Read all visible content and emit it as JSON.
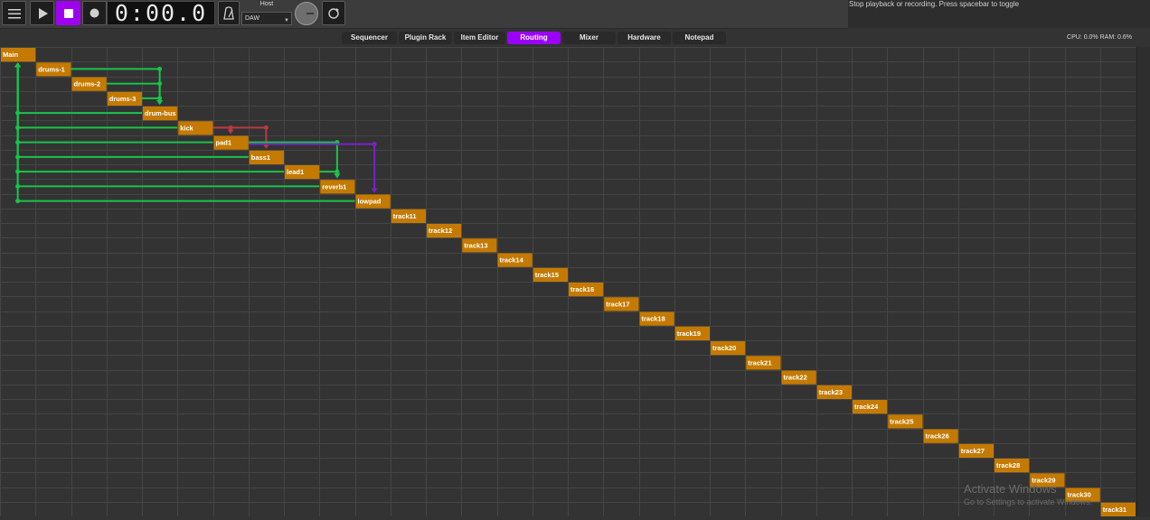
{
  "status_text": "Stop playback or recording.  Press spacebar to toggle",
  "toolbar": {
    "time": "0:00.0",
    "host_label": "Host",
    "host_value": "DAW"
  },
  "tabs": [
    {
      "label": "Sequencer",
      "active": false
    },
    {
      "label": "Plugin Rack",
      "active": false
    },
    {
      "label": "Item Editor",
      "active": false
    },
    {
      "label": "Routing",
      "active": true
    },
    {
      "label": "Mixer",
      "active": false
    },
    {
      "label": "Hardware",
      "active": false
    },
    {
      "label": "Notepad",
      "active": false
    }
  ],
  "cpu_ram": "CPU: 0.0% RAM: 0.6%",
  "nodes": [
    "Main",
    "drums-1",
    "drums-2",
    "drums-3",
    "drum-bus",
    "kick",
    "pad1",
    "bass1",
    "lead1",
    "reverb1",
    "lowpad",
    "track11",
    "track12",
    "track13",
    "track14",
    "track15",
    "track16",
    "track17",
    "track18",
    "track19",
    "track20",
    "track21",
    "track22",
    "track23",
    "track24",
    "track25",
    "track26",
    "track27",
    "track28",
    "track29",
    "track30",
    "track31"
  ],
  "colors": {
    "node": "#c47a00",
    "route_main": "#19c44a",
    "route_red": "#b83a44",
    "route_purple": "#7a22c8",
    "accent": "#9b00ff"
  },
  "routes": [
    {
      "from": "drums-1",
      "to": "drum-bus",
      "color": "green"
    },
    {
      "from": "drums-2",
      "to": "drum-bus",
      "color": "green"
    },
    {
      "from": "drums-3",
      "to": "drum-bus",
      "color": "green"
    },
    {
      "from": "drum-bus",
      "to": "Main",
      "color": "green"
    },
    {
      "from": "kick",
      "to": "Main",
      "color": "green"
    },
    {
      "from": "kick",
      "to": "pad1",
      "color": "red"
    },
    {
      "from": "kick",
      "to": "bass1",
      "color": "red"
    },
    {
      "from": "pad1",
      "to": "Main",
      "color": "green"
    },
    {
      "from": "pad1",
      "to": "reverb1",
      "color": "green"
    },
    {
      "from": "pad1",
      "to": "lowpad",
      "color": "purple"
    },
    {
      "from": "bass1",
      "to": "Main",
      "color": "green"
    },
    {
      "from": "lead1",
      "to": "Main",
      "color": "green"
    },
    {
      "from": "lead1",
      "to": "reverb1",
      "color": "green"
    },
    {
      "from": "reverb1",
      "to": "Main",
      "color": "green"
    },
    {
      "from": "lowpad",
      "to": "Main",
      "color": "green"
    }
  ],
  "watermark": {
    "line1": "Activate Windows",
    "line2": "Go to Settings to activate Windows."
  }
}
